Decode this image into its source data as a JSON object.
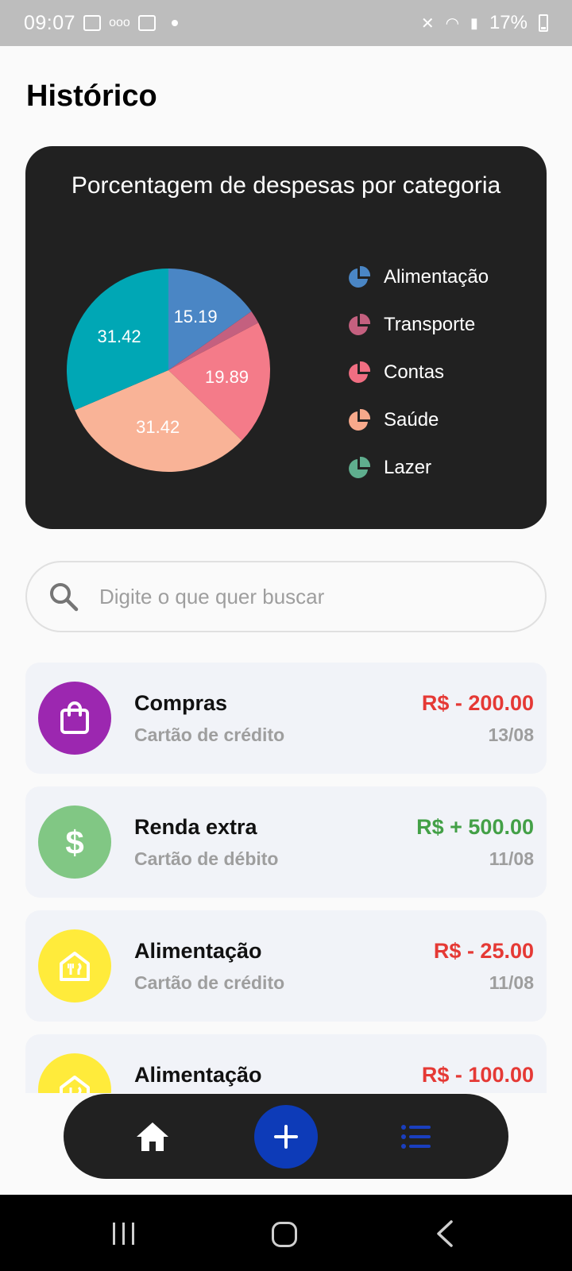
{
  "status_bar": {
    "time": "09:07",
    "battery": "17%"
  },
  "page": {
    "title": "Histórico"
  },
  "chart_card": {
    "title": "Porcentagem de despesas por categoria",
    "legend": [
      {
        "label": "Alimentação",
        "color": "#4a86c5"
      },
      {
        "label": "Transporte",
        "color": "#c4607f"
      },
      {
        "label": "Contas",
        "color": "#f06e82"
      },
      {
        "label": "Saúde",
        "color": "#f7a98b"
      },
      {
        "label": "Lazer",
        "color": "#5fae8e"
      }
    ]
  },
  "chart_data": {
    "type": "pie",
    "categories": [
      "Alimentação",
      "Transporte",
      "Contas",
      "Saúde",
      "Lazer"
    ],
    "values": [
      15.19,
      2.08,
      19.89,
      31.42,
      31.42
    ],
    "slice_colors": [
      "#4a86c5",
      "#c4607f",
      "#f47b89",
      "#f9b397",
      "#00a7b5"
    ],
    "data_labels": [
      "15.19",
      "",
      "19.89",
      "31.42",
      "31.42"
    ]
  },
  "search": {
    "placeholder": "Digite o que quer buscar",
    "value": ""
  },
  "transactions": [
    {
      "title": "Compras",
      "method": "Cartão de crédito",
      "amount": "R$ - 200.00",
      "date": "13/08",
      "icon": "shopping-bag-icon",
      "icon_bg": "#9c27b0",
      "amount_color": "#e53935"
    },
    {
      "title": "Renda extra",
      "method": "Cartão de débito",
      "amount": "R$ + 500.00",
      "date": "11/08",
      "icon": "dollar-icon",
      "icon_bg": "#81c784",
      "amount_color": "#43a047"
    },
    {
      "title": "Alimentação",
      "method": "Cartão de crédito",
      "amount": "R$ - 25.00",
      "date": "11/08",
      "icon": "restaurant-icon",
      "icon_bg": "#ffeb3b",
      "amount_color": "#e53935"
    },
    {
      "title": "Alimentação",
      "method": "",
      "amount": "R$ - 100.00",
      "date": "",
      "icon": "restaurant-icon",
      "icon_bg": "#ffeb3b",
      "amount_color": "#e53935"
    }
  ],
  "bottom_nav": {
    "items": [
      {
        "icon": "home-icon"
      },
      {
        "icon": "add-icon"
      },
      {
        "icon": "list-icon"
      }
    ],
    "add_color": "#0d3bb8",
    "active_color": "#1a3fbf"
  }
}
